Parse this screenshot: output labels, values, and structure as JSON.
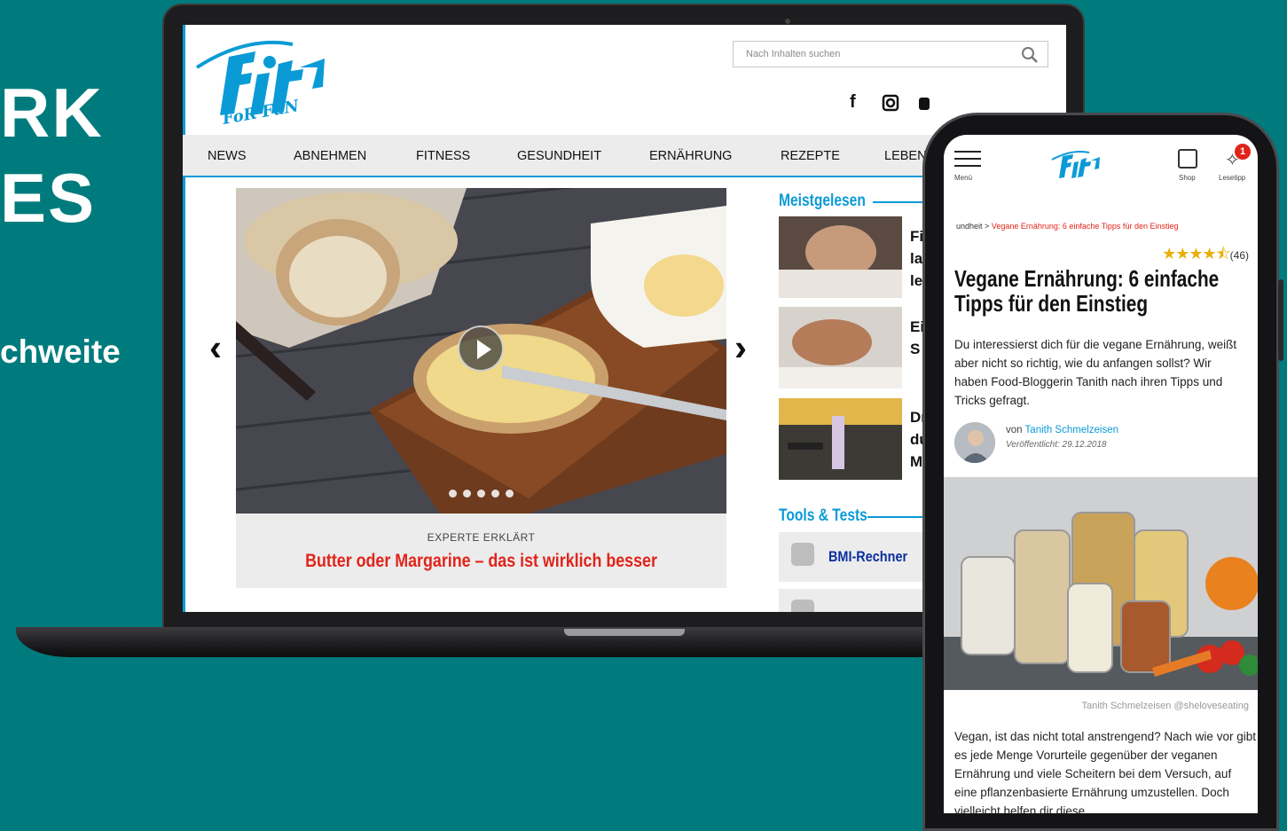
{
  "slide": {
    "heading_line1": "RK",
    "heading_line2": "ES",
    "subline": "chweite"
  },
  "desktop": {
    "search": {
      "placeholder": "Nach Inhalten suchen"
    },
    "nav": [
      "NEWS",
      "ABNEHMEN",
      "FITNESS",
      "GESUNDHEIT",
      "ERNÄHRUNG",
      "REZEPTE",
      "LEBEN"
    ],
    "hero": {
      "kicker": "EXPERTE ERKLÄRT",
      "title": "Butter oder Margarine – das ist wirklich besser",
      "slides": 5
    },
    "sidebar": {
      "most_read_heading": "Meistgelesen",
      "most_read": [
        {
          "text_line1": "Fi",
          "text_line2": "la",
          "text_line3": "le"
        },
        {
          "text_line1": "Ei",
          "text_line2": "S",
          "text_line3": ""
        },
        {
          "text_line1": "Dr",
          "text_line2": "du",
          "text_line3": "M"
        }
      ],
      "tools_heading": "Tools & Tests",
      "tools": [
        "BMI-Rechner"
      ]
    }
  },
  "mobile": {
    "menu_label": "Menü",
    "shop_label": "Shop",
    "tips_label": "Lesetipp",
    "tips_badge": "1",
    "breadcrumb_prev": "undheit",
    "breadcrumb_sep": ">",
    "breadcrumb_current": "Vegane Ernährung: 6 einfache Tipps für den Einstieg",
    "stars": "★★★★⯪",
    "rating_count": "(46)",
    "title": "Vegane Ernährung: 6 einfache Tipps für den Einstieg",
    "lead": "Du interessierst dich für die vegane Ernährung, weißt aber nicht so richtig, wie du anfangen sollst? Wir haben Food-Bloggerin Tanith nach ihren Tipps und Tricks gefragt.",
    "author_prefix": "von",
    "author": "Tanith Schmelzeisen",
    "published": "Veröffentlicht: 29.12.2018",
    "photo_credit": "Tanith Schmelzeisen @sheloveseating",
    "body": "Vegan, ist das nicht total anstrengend? Nach wie vor gibt es jede Menge Vorurteile gegenüber der veganen Ernährung und viele Scheitern bei dem Versuch, auf eine pflanzenbasierte Ernährung umzustellen. Doch vielleicht helfen dir diese"
  },
  "colors": {
    "background": "#007b7d",
    "brand_blue": "#0a9bd6",
    "accent_red": "#e2231a",
    "star": "#e8b00a"
  }
}
